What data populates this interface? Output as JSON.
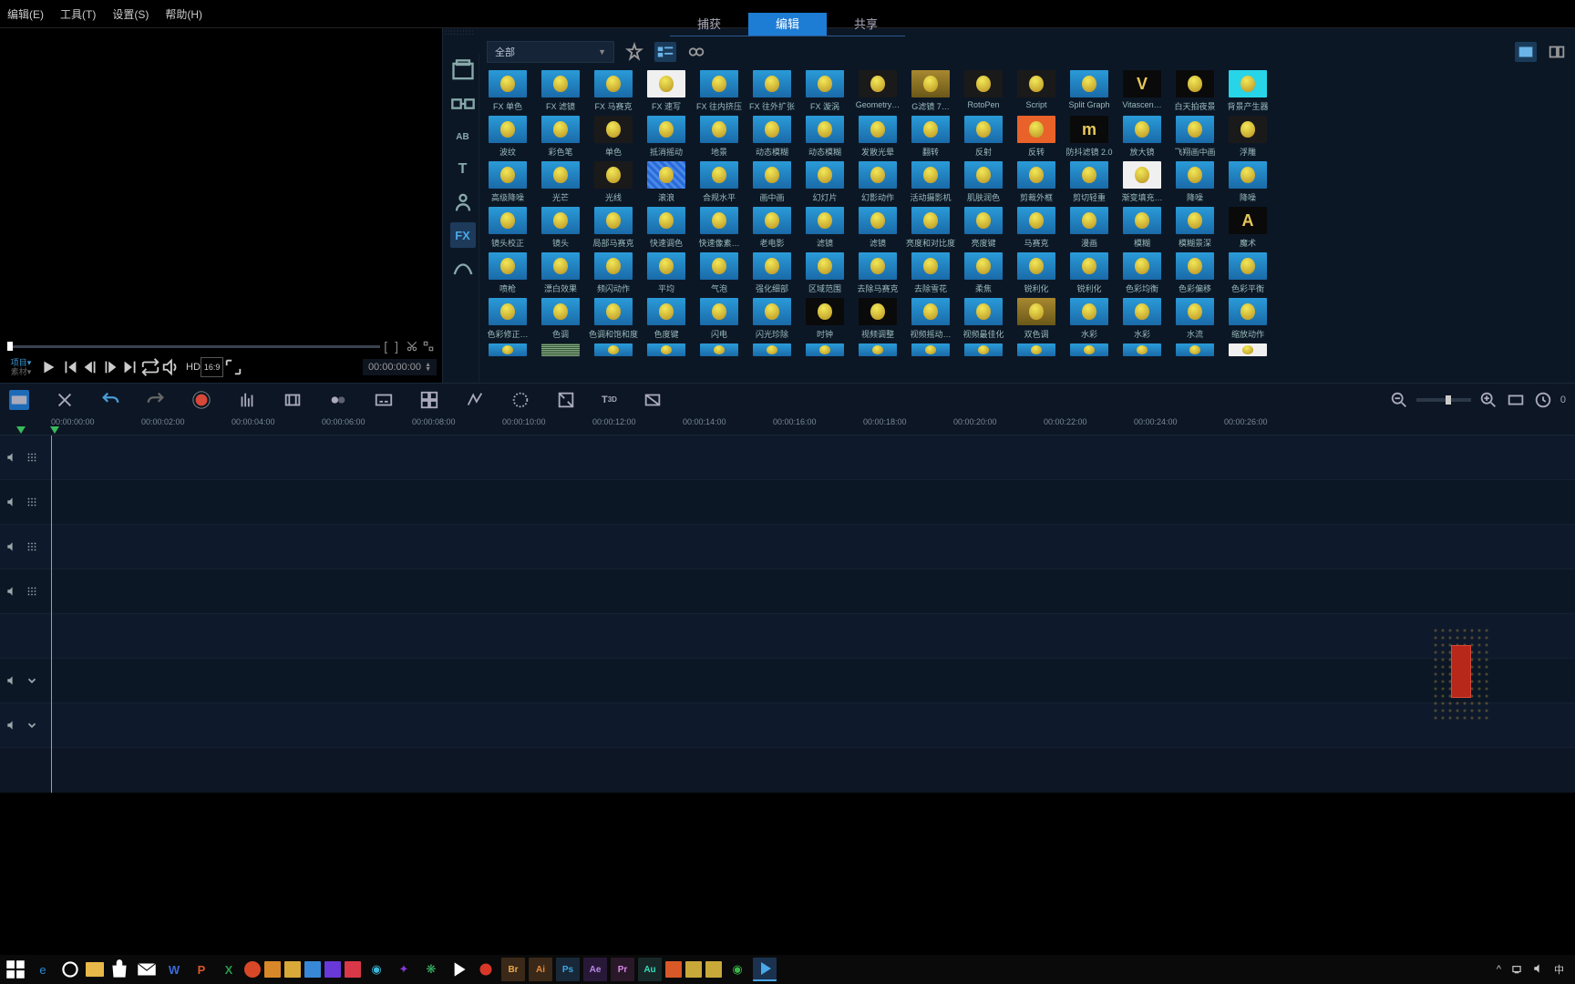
{
  "menu": {
    "edit": "编辑(E)",
    "tools": "工具(T)",
    "settings": "设置(S)",
    "help": "帮助(H)"
  },
  "tabs": {
    "capture": "捕获",
    "edit": "编辑",
    "share": "共享"
  },
  "preview": {
    "mode_project": "项目▾",
    "mode_clip": "素材▾",
    "hd": "HD",
    "aspect": "16:9",
    "timecode": "00:00:00:00"
  },
  "library": {
    "dropdown": "全部",
    "items_row1": [
      "FX 单色",
      "FX 滤镜",
      "FX 马赛克",
      "FX 速写",
      "FX 往内挤压",
      "FX 往外扩张",
      "FX 漩涡",
      "Geometry…",
      "G滤镜 7…",
      "RotoPen",
      "Script",
      "Split Graph",
      "Vitascen…",
      "白天拍夜景",
      "背景产生器"
    ],
    "items_row2": [
      "波纹",
      "彩色笔",
      "单色",
      "抵消摇动",
      "地景",
      "动态模糊",
      "动态模糊",
      "发散光晕",
      "翻转",
      "反射",
      "反转",
      "防抖滤镜 2.0",
      "放大镜",
      "飞翔画中画",
      "浮雕"
    ],
    "items_row3": [
      "高级降噪",
      "光芒",
      "光线",
      "滚浪",
      "合规水平",
      "画中画",
      "幻灯片",
      "幻影动作",
      "活动摄影机",
      "肌肤润色",
      "剪裁外框",
      "剪切轻重",
      "渐变填充…",
      "降噪",
      "降噪"
    ],
    "items_row4": [
      "镜头校正",
      "镜头",
      "局部马赛克",
      "快速调色",
      "快速像素…",
      "老电影",
      "滤镜",
      "滤镜",
      "亮度和对比度",
      "亮度键",
      "马赛克",
      "漫画",
      "模糊",
      "模糊景深",
      "魔术"
    ],
    "items_row5": [
      "喷枪",
      "漂白效果",
      "频闪动作",
      "平均",
      "气泡",
      "强化细部",
      "区域范围",
      "去除马赛克",
      "去除雪花",
      "柔焦",
      "锐利化",
      "锐利化",
      "色彩均衡",
      "色彩偏移",
      "色彩平衡"
    ],
    "items_row6": [
      "色彩修正…",
      "色调",
      "色调和饱和度",
      "色度键",
      "闪电",
      "闪光珍除",
      "时钟",
      "视频调整",
      "视频摇动…",
      "视频最佳化",
      "双色调",
      "水彩",
      "水彩",
      "水流",
      "缩放动作"
    ],
    "special_thumbs": {
      "0_3": "white",
      "0_7": "dark",
      "0_8": "gold",
      "0_9": "dark",
      "0_10": "dark",
      "0_13": "blk",
      "0_14": "cyan",
      "1_2": "dark",
      "1_10": "orange",
      "1_11": "dark",
      "1_14": "dark",
      "2_2": "dark",
      "2_3": "stripe",
      "2_12": "white",
      "3_14": "dark",
      "5_6": "blk",
      "5_7": "blk",
      "5_10": "gold"
    },
    "letter_thumbs": {
      "0_12": "V",
      "1_11": "m",
      "3_14": "A"
    }
  },
  "ruler": {
    "marks": [
      "00:00:00:00",
      "00:00:02:00",
      "00:00:04:00",
      "00:00:06:00",
      "00:00:08:00",
      "00:00:10:00",
      "00:00:12:00",
      "00:00:14:00",
      "00:00:16:00",
      "00:00:18:00",
      "00:00:20:00",
      "00:00:22:00",
      "00:00:24:00",
      "00:00:26:00"
    ]
  },
  "taskbar": {
    "tray_ime": "中"
  }
}
